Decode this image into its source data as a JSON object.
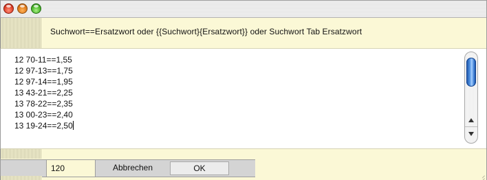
{
  "window": {
    "controls": [
      {
        "name": "close",
        "color": "#e0442b"
      },
      {
        "name": "minimize",
        "color": "#e07b1c"
      },
      {
        "name": "zoom",
        "color": "#4cb82c"
      }
    ]
  },
  "info": {
    "hint": "Suchwort==Ersatzwort oder {{Suchwort}{Ersatzwort}} oder Suchwort Tab Ersatzwort"
  },
  "editor": {
    "lines": [
      "12 70-11==1,55",
      "12 97-13==1,75",
      "12 97-14==1,95",
      "13 43-21==2,25",
      "13 78-22==2,35",
      "13 00-23==2,40",
      "13 19-24==2,50"
    ],
    "scroll_position": 0
  },
  "footer": {
    "count": "120",
    "cancel_label": "Abbrechen",
    "ok_label": "OK"
  }
}
